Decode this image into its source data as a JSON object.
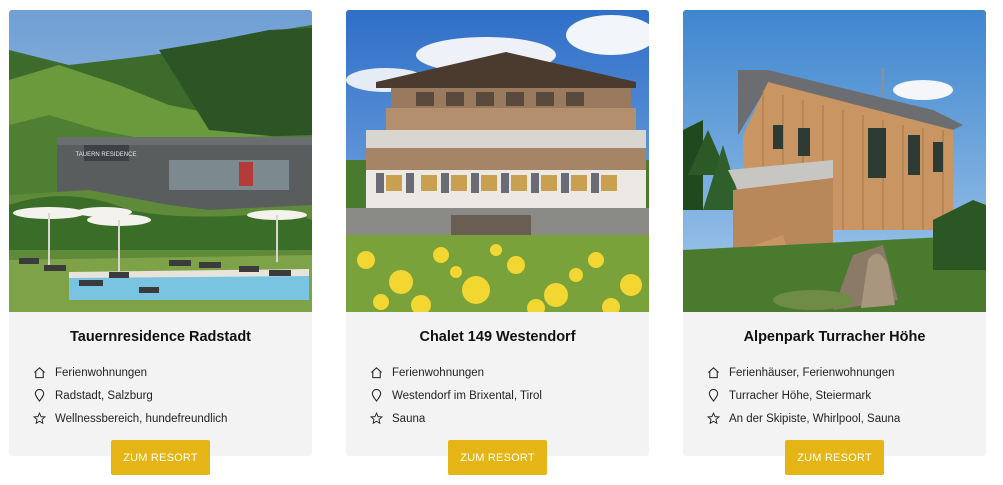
{
  "resorts": [
    {
      "title": "Tauernresidence Radstadt",
      "photo_sign": "TAUERN RESIDENCE",
      "features": [
        {
          "icon": "home-icon",
          "text": "Ferienwohnungen"
        },
        {
          "icon": "location-pin-icon",
          "text": "Radstadt, Salzburg"
        },
        {
          "icon": "star-icon",
          "text": "Wellnessbereich, hundefreundlich"
        }
      ],
      "button_label": "ZUM RESORT"
    },
    {
      "title": "Chalet 149 Westendorf",
      "features": [
        {
          "icon": "home-icon",
          "text": "Ferienwohnungen"
        },
        {
          "icon": "location-pin-icon",
          "text": "Westendorf im Brixental, Tirol"
        },
        {
          "icon": "star-icon",
          "text": "Sauna"
        }
      ],
      "button_label": "ZUM RESORT"
    },
    {
      "title": "Alpenpark Turracher Höhe",
      "features": [
        {
          "icon": "home-icon",
          "text": "Ferienhäuser, Ferienwohnungen"
        },
        {
          "icon": "location-pin-icon",
          "text": "Turracher Höhe, Steiermark"
        },
        {
          "icon": "star-icon",
          "text": "An der Skipiste, Whirlpool, Sauna"
        }
      ],
      "button_label": "ZUM RESORT"
    }
  ],
  "colors": {
    "card_background": "#f3f3f3",
    "button_background": "#e4b514",
    "button_text": "#ffffff",
    "title_text": "#111111"
  }
}
